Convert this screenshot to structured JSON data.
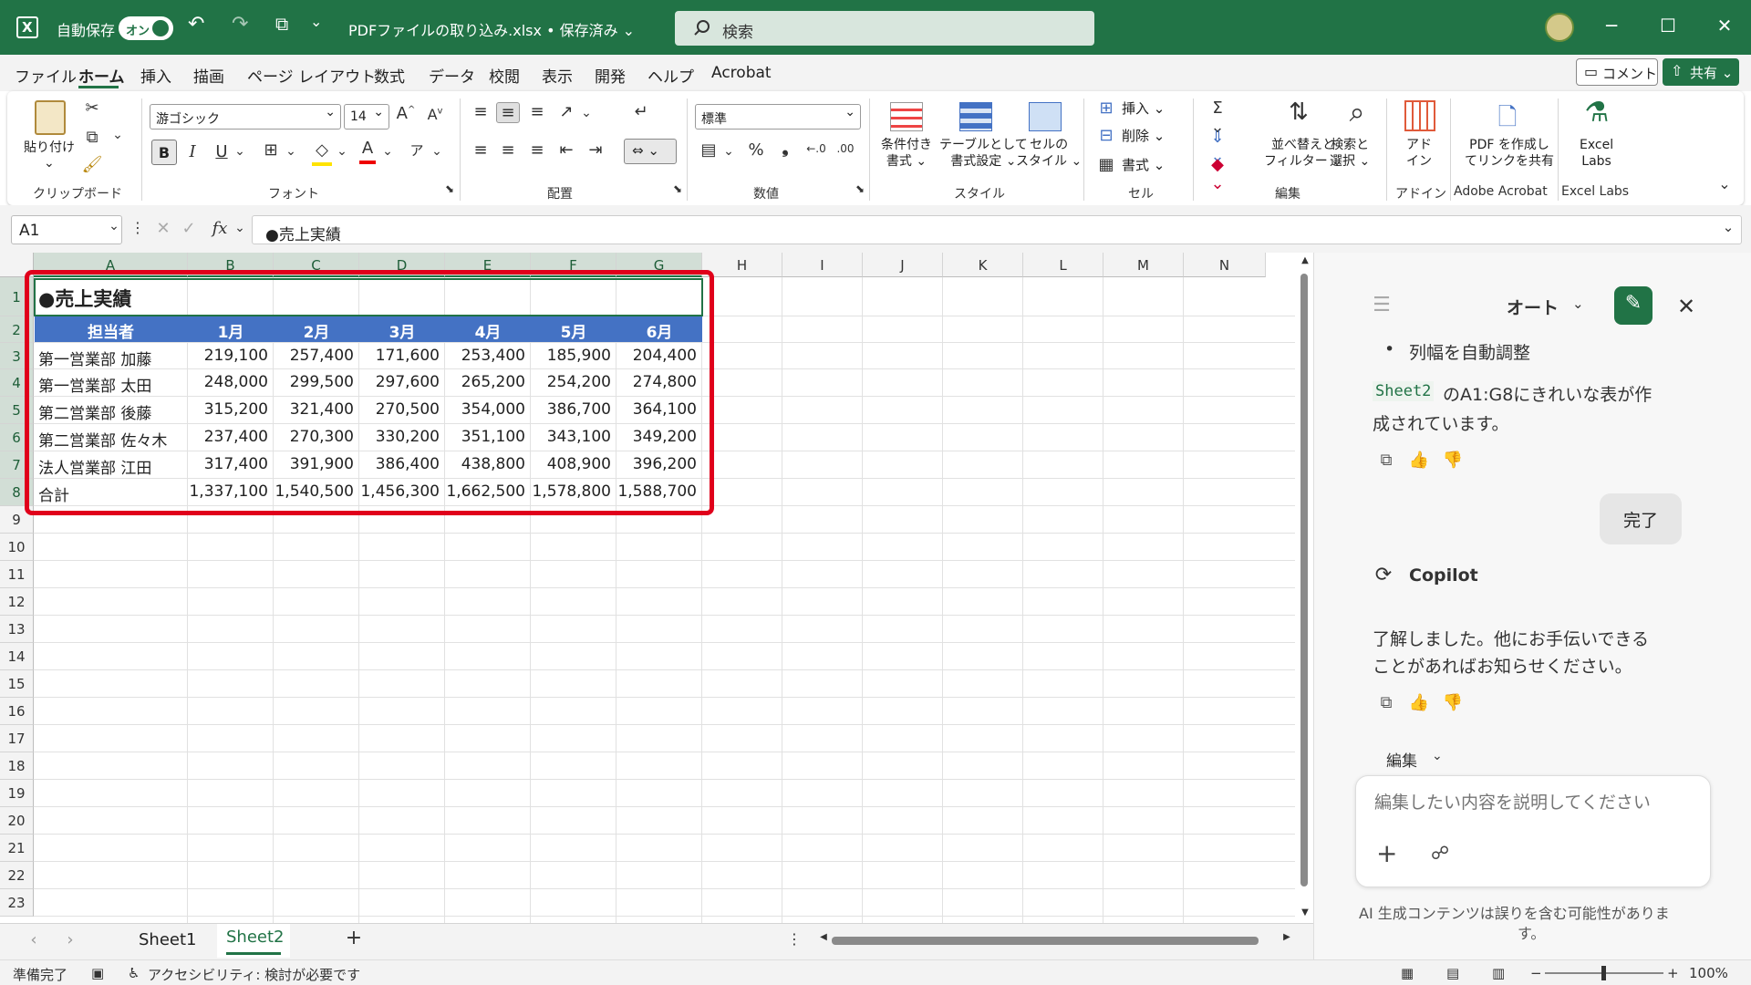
{
  "titlebar": {
    "autosave_label": "自動保存",
    "autosave_state": "オン",
    "filename": "PDFファイルの取り込み.xlsx • 保存済み ⌄",
    "search_placeholder": "検索"
  },
  "menu_tabs": [
    "ファイル",
    "ホーム",
    "挿入",
    "描画",
    "ページ レイアウト",
    "数式",
    "データ",
    "校閲",
    "表示",
    "開発",
    "ヘルプ",
    "Acrobat"
  ],
  "header_buttons": {
    "comment": "コメント",
    "share": "共有 ⌄"
  },
  "ribbon": {
    "clipboard": {
      "paste": "貼り付け",
      "label": "クリップボード"
    },
    "font": {
      "name": "游ゴシック",
      "size": "14",
      "bold": "B",
      "italic": "I",
      "underline": "U",
      "label": "フォント"
    },
    "alignment": {
      "label": "配置"
    },
    "number": {
      "format": "標準",
      "percent": "%",
      "label": "数値"
    },
    "styles": {
      "conditional": [
        "条件付き",
        "書式 ⌄"
      ],
      "table": [
        "テーブルとして",
        "書式設定 ⌄"
      ],
      "cell": [
        "セルの",
        "スタイル ⌄"
      ],
      "label": "スタイル"
    },
    "cells": {
      "insert": "挿入 ⌄",
      "delete": "削除 ⌄",
      "format": "書式 ⌄",
      "label": "セル"
    },
    "editing": {
      "sort": [
        "並べ替えと",
        "フィルター ⌄"
      ],
      "find": [
        "検索と",
        "選択 ⌄"
      ],
      "label": "編集"
    },
    "addins": {
      "addin": [
        "アド",
        "イン"
      ],
      "label": "アドイン"
    },
    "acrobat": {
      "pdf": [
        "PDF を作成し",
        "てリンクを共有"
      ],
      "label": "Adobe Acrobat"
    },
    "excel_labs": {
      "name": [
        "Excel",
        "Labs"
      ],
      "label": "Excel Labs"
    }
  },
  "formula_bar": {
    "name_box": "A1",
    "fx": "fx",
    "formula": "●売上実績"
  },
  "sheet": {
    "columns": [
      "A",
      "B",
      "C",
      "D",
      "E",
      "F",
      "G",
      "H",
      "I",
      "J",
      "K",
      "L",
      "M",
      "N"
    ],
    "rows": [
      "1",
      "2",
      "3",
      "4",
      "5",
      "6",
      "7",
      "8",
      "9",
      "10",
      "11",
      "12",
      "13",
      "14",
      "15",
      "16",
      "17",
      "18",
      "19",
      "20",
      "21",
      "22",
      "23"
    ],
    "title": "●売上実績",
    "headers": [
      "担当者",
      "1月",
      "2月",
      "3月",
      "4月",
      "5月",
      "6月"
    ],
    "data": [
      [
        "第一営業部 加藤",
        "219,100",
        "257,400",
        "171,600",
        "253,400",
        "185,900",
        "204,400"
      ],
      [
        "第一営業部 太田",
        "248,000",
        "299,500",
        "297,600",
        "265,200",
        "254,200",
        "274,800"
      ],
      [
        "第二営業部 後藤",
        "315,200",
        "321,400",
        "270,500",
        "354,000",
        "386,700",
        "364,100"
      ],
      [
        "第二営業部 佐々木",
        "237,400",
        "270,300",
        "330,200",
        "351,100",
        "343,100",
        "349,200"
      ],
      [
        "法人営業部 江田",
        "317,400",
        "391,900",
        "386,400",
        "438,800",
        "408,900",
        "396,200"
      ],
      [
        "合計",
        "1,337,100",
        "1,540,500",
        "1,456,300",
        "1,662,500",
        "1,578,800",
        "1,588,700"
      ]
    ],
    "header_color": "#4472c4"
  },
  "sheet_tabs": [
    "Sheet1",
    "Sheet2"
  ],
  "copilot": {
    "mode": "オート",
    "bullet": "列幅を自動調整",
    "code": "Sheet2",
    "msg1_line1": "のA1:G8にきれいな表が作",
    "msg1_line2": "成されています。",
    "user_msg": "完了",
    "name": "Copilot",
    "msg2_line1": "了解しました。他にお手伝いできる",
    "msg2_line2": "ことがあればお知らせください。",
    "edit_label": "編集",
    "input_placeholder": "編集したい内容を説明してください",
    "disclaimer_line1": "AI 生成コンテンツは誤りを含む可能性がありま",
    "disclaimer_line2": "す。"
  },
  "status": {
    "ready": "準備完了",
    "accessibility": "アクセシビリティ: 検討が必要です",
    "zoom": "100%"
  },
  "accent_color": "#217346",
  "highlight_color": "#e0001b"
}
